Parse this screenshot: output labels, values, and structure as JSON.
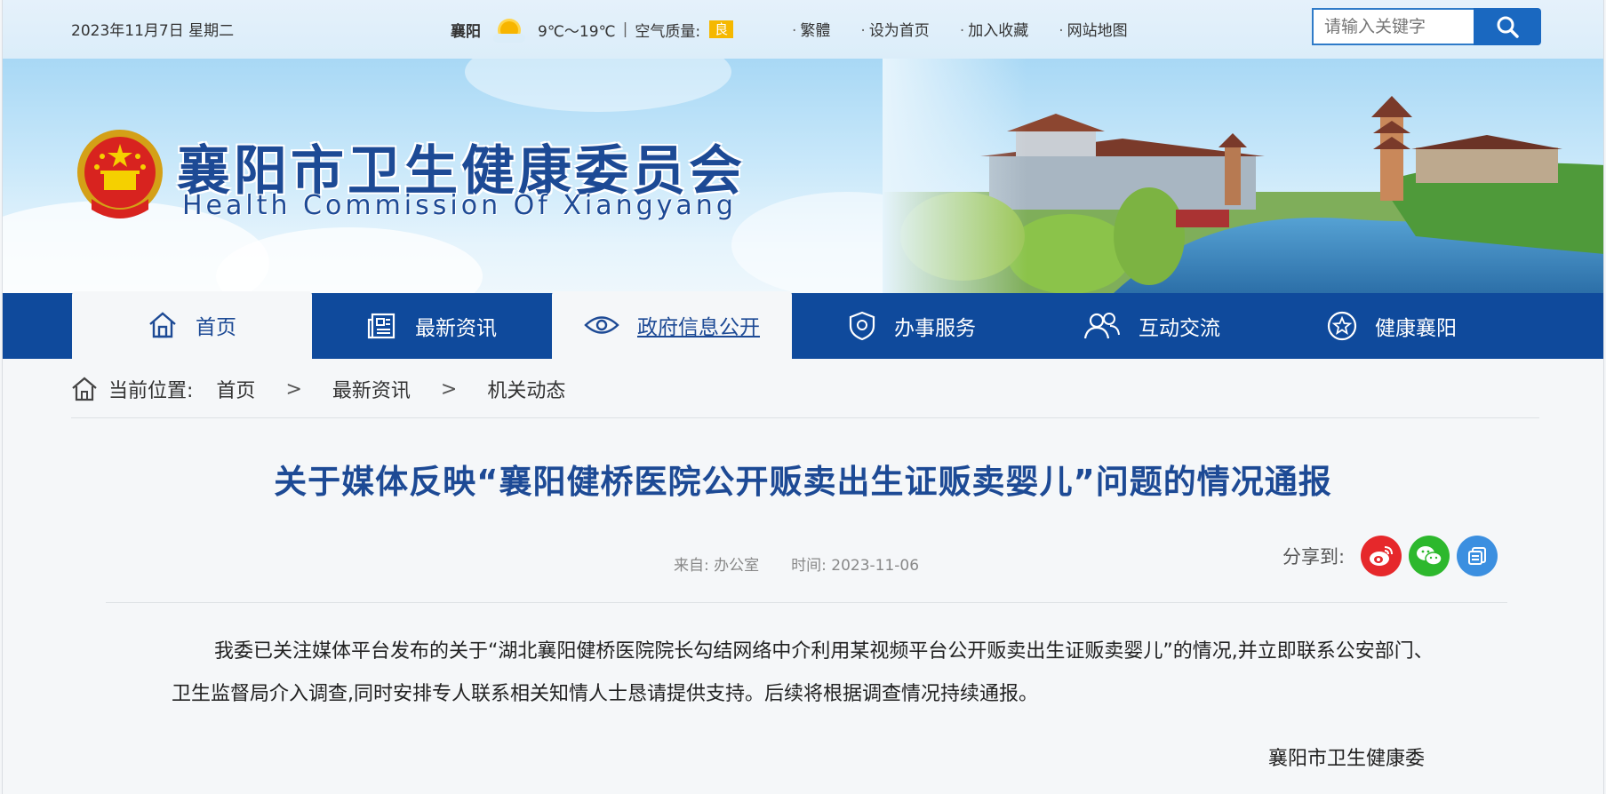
{
  "topbar": {
    "date": "2023年11月7日 星期二",
    "weather_city": "襄阳",
    "weather_icon": "sunny-icon",
    "temperature": "9℃～19℃",
    "air_quality_label": "空气质量:",
    "air_quality_value": "良",
    "links": [
      "繁體",
      "设为首页",
      "加入收藏",
      "网站地图"
    ],
    "search_placeholder": "请输入关键字"
  },
  "banner": {
    "title": "襄阳市卫生健康委员会",
    "subtitle": "Health Commission Of Xiangyang"
  },
  "nav": {
    "items": [
      {
        "label": "首页",
        "icon": "home-icon"
      },
      {
        "label": "最新资讯",
        "icon": "newspaper-icon"
      },
      {
        "label": "政府信息公开",
        "icon": "eye-icon"
      },
      {
        "label": "办事服务",
        "icon": "shield-icon"
      },
      {
        "label": "互动交流",
        "icon": "people-icon"
      },
      {
        "label": "健康襄阳",
        "icon": "star-icon"
      }
    ]
  },
  "breadcrumb": {
    "prefix": "当前位置:",
    "items": [
      "首页",
      "最新资讯",
      "机关动态"
    ],
    "separator": ">"
  },
  "article": {
    "title": "关于媒体反映“襄阳健桥医院公开贩卖出生证贩卖婴儿”问题的情况通报",
    "source": "来自:  办公室",
    "time": "时间:  2023-11-06",
    "share_label": "分享到:",
    "body": "我委已关注媒体平台发布的关于“湖北襄阳健桥医院院长勾结网络中介利用某视频平台公开贩卖出生证贩卖婴儿”的情况,并立即联系公安部门、卫生监督局介入调查,同时安排专人联系相关知情人士恳请提供支持。后续将根据调查情况持续通报。",
    "signature": "襄阳市卫生健康委"
  },
  "colors": {
    "nav_bg": "#0f4a9c",
    "title_blue": "#1d4a95",
    "weibo": "#e6282b",
    "wechat": "#2db82d",
    "qzone": "#3b8fe0",
    "aq_badge": "#f5b800"
  }
}
